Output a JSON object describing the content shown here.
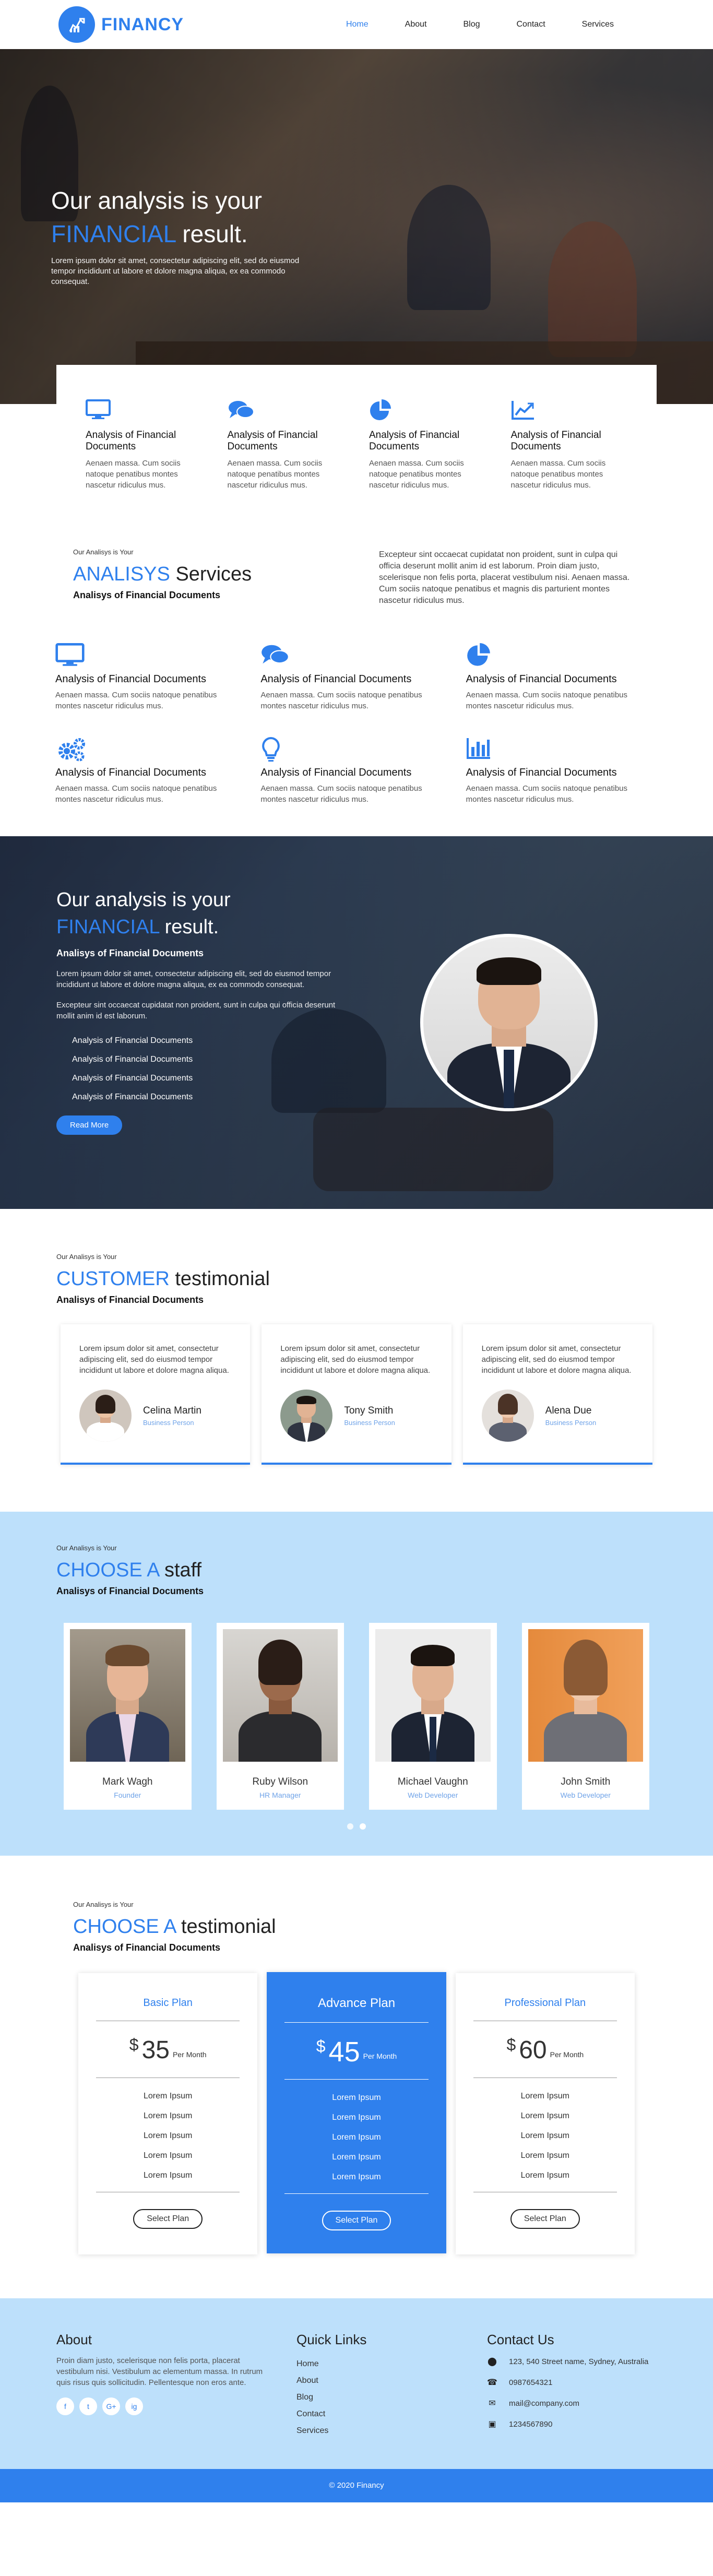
{
  "brand": {
    "name": "FINANCY"
  },
  "nav": {
    "items": [
      "Home",
      "About",
      "Blog",
      "Contact",
      "Services"
    ]
  },
  "hero": {
    "title_line1": "Our analysis is your",
    "title_accent": "FINANCIAL",
    "title_rest": "result.",
    "text": "Lorem ipsum dolor sit amet, consectetur adipiscing elit, sed do eiusmod tempor incididunt ut labore et dolore magna aliqua, ex ea commodo consequat."
  },
  "features": [
    {
      "icon": "monitor-icon",
      "title": "Analysis of Financial Documents",
      "text": "Aenaen massa. Cum sociis natoque penatibus montes nascetur ridiculus mus."
    },
    {
      "icon": "chat-icon",
      "title": "Analysis of Financial Documents",
      "text": "Aenaen massa. Cum sociis natoque penatibus montes nascetur ridiculus mus."
    },
    {
      "icon": "pie-chart-icon",
      "title": "Analysis of Financial Documents",
      "text": "Aenaen massa. Cum sociis natoque penatibus montes nascetur ridiculus mus."
    },
    {
      "icon": "line-chart-icon",
      "title": "Analysis of Financial Documents",
      "text": "Aenaen massa. Cum sociis natoque penatibus montes nascetur ridiculus mus."
    }
  ],
  "services": {
    "eyebrow": "Our Analisys is Your",
    "title_accent": "ANALISYS",
    "title_rest": "Services",
    "subtitle": "Analisys of Financial Documents",
    "text": "Excepteur sint occaecat cupidatat non proident, sunt in culpa qui officia deserunt mollit anim id est laborum. Proin diam justo, scelerisque non felis porta, placerat vestibulum nisi. Aenaen massa. Cum sociis natoque penatibus et magnis dis parturient montes nascetur ridiculus mus.",
    "items": [
      {
        "icon": "monitor-icon",
        "title": "Analysis of Financial Documents",
        "text": "Aenaen massa. Cum sociis natoque penatibus montes nascetur ridiculus mus."
      },
      {
        "icon": "chat-icon",
        "title": "Analysis of Financial Documents",
        "text": "Aenaen massa. Cum sociis natoque penatibus montes nascetur ridiculus mus."
      },
      {
        "icon": "pie-chart-icon",
        "title": "Analysis of Financial Documents",
        "text": "Aenaen massa. Cum sociis natoque penatibus montes nascetur ridiculus mus."
      },
      {
        "icon": "gears-icon",
        "title": "Analysis of Financial Documents",
        "text": "Aenaen massa. Cum sociis natoque penatibus montes nascetur ridiculus mus."
      },
      {
        "icon": "lightbulb-icon",
        "title": "Analysis of Financial Documents",
        "text": "Aenaen massa. Cum sociis natoque penatibus montes nascetur ridiculus mus."
      },
      {
        "icon": "bar-chart-icon",
        "title": "Analysis of Financial Documents",
        "text": "Aenaen massa. Cum sociis natoque penatibus montes nascetur ridiculus mus."
      }
    ]
  },
  "band": {
    "title_line1": "Our analysis is your",
    "title_accent": "FINANCIAL",
    "title_rest": "result.",
    "subtitle": "Analisys of Financial Documents",
    "text1": "Lorem ipsum dolor sit amet, consectetur adipiscing elit, sed do eiusmod tempor incididunt ut labore et dolore magna aliqua, ex ea commodo consequat.",
    "text2": "Excepteur sint occaecat cupidatat non proident, sunt in culpa qui officia deserunt mollit anim id est laborum.",
    "list": [
      "Analysis of Financial Documents",
      "Analysis of Financial Documents",
      "Analysis of Financial Documents",
      "Analysis of Financial Documents"
    ],
    "button": "Read More"
  },
  "testimonials": {
    "eyebrow": "Our Analisys is Your",
    "title_accent": "CUSTOMER",
    "title_rest": "testimonial",
    "subtitle": "Analisys of Financial Documents",
    "items": [
      {
        "text": "Lorem ipsum dolor sit amet, consectetur adipiscing elit, sed do eiusmod tempor incididunt ut labore et dolore magna aliqua.",
        "name": "Celina Martin",
        "role": "Business Person"
      },
      {
        "text": "Lorem ipsum dolor sit amet, consectetur adipiscing elit, sed do eiusmod tempor incididunt ut labore et dolore magna aliqua.",
        "name": "Tony Smith",
        "role": "Business Person"
      },
      {
        "text": "Lorem ipsum dolor sit amet, consectetur adipiscing elit, sed do eiusmod tempor incididunt ut labore et dolore magna aliqua.",
        "name": "Alena Due",
        "role": "Business Person"
      }
    ]
  },
  "staff": {
    "eyebrow": "Our Analisys is Your",
    "title_accent": "CHOOSE A",
    "title_rest": "staff",
    "subtitle": "Analisys of Financial Documents",
    "members": [
      {
        "name": "Mark Wagh",
        "role": "Founder"
      },
      {
        "name": "Ruby Wilson",
        "role": "HR Manager"
      },
      {
        "name": "Michael Vaughn",
        "role": "Web Developer"
      },
      {
        "name": "John Smith",
        "role": "Web Developer"
      }
    ]
  },
  "pricing": {
    "eyebrow": "Our Analisys is Your",
    "title_accent": "CHOOSE A",
    "title_rest": "testimonial",
    "subtitle": "Analisys of Financial Documents",
    "plans": [
      {
        "name": "Basic Plan",
        "currency": "$",
        "price": "35",
        "period": "Per Month",
        "features": [
          "Lorem Ipsum",
          "Lorem Ipsum",
          "Lorem Ipsum",
          "Lorem Ipsum",
          "Lorem Ipsum"
        ],
        "button": "Select Plan"
      },
      {
        "name": "Advance Plan",
        "currency": "$",
        "price": "45",
        "period": "Per Month",
        "features": [
          "Lorem Ipsum",
          "Lorem Ipsum",
          "Lorem Ipsum",
          "Lorem Ipsum",
          "Lorem Ipsum"
        ],
        "button": "Select Plan"
      },
      {
        "name": "Professional Plan",
        "currency": "$",
        "price": "60",
        "period": "Per Month",
        "features": [
          "Lorem Ipsum",
          "Lorem Ipsum",
          "Lorem Ipsum",
          "Lorem Ipsum",
          "Lorem Ipsum"
        ],
        "button": "Select Plan"
      }
    ]
  },
  "footer": {
    "about_title": "About",
    "about_text": "Proin diam justo, scelerisque non felis porta, placerat vestibulum nisi. Vestibulum ac elementum massa. In rutrum quis risus quis sollicitudin. Pellentesque non eros ante.",
    "socials": [
      "f",
      "t",
      "G+",
      "ig"
    ],
    "links_title": "Quick Links",
    "links": [
      "Home",
      "About",
      "Blog",
      "Contact",
      "Services"
    ],
    "contact_title": "Contact Us",
    "contact": [
      {
        "icon": "location-icon",
        "text": "123, 540 Street name, Sydney, Australia"
      },
      {
        "icon": "phone-icon",
        "text": "0987654321"
      },
      {
        "icon": "mail-icon",
        "text": "mail@company.com"
      },
      {
        "icon": "fax-icon",
        "text": "1234567890"
      }
    ],
    "copyright": "© 2020 Financy"
  },
  "colors": {
    "accent": "#2f80ed",
    "light_band": "#bde0fb"
  }
}
